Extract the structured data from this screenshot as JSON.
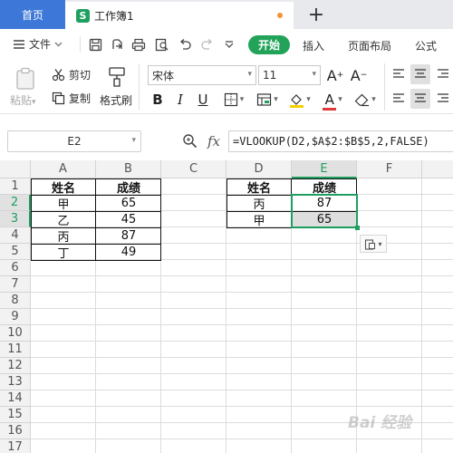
{
  "tabs": {
    "home": "首页",
    "document": "工作簿1",
    "doc_badge": "S",
    "new_tab": "+"
  },
  "menu": {
    "file": "文件",
    "start": "开始",
    "insert": "插入",
    "page_layout": "页面布局",
    "formula": "公式"
  },
  "ribbon": {
    "paste": "粘贴",
    "cut": "剪切",
    "copy": "复制",
    "format_painter": "格式刷",
    "font_name": "宋体",
    "font_size": "11",
    "bold": "B",
    "italic": "I",
    "underline": "U",
    "font_color_letter": "A",
    "font_color": "#e03b3b",
    "highlight_color": "#f5d000"
  },
  "formula_bar": {
    "cell_ref": "E2",
    "fx": "fx",
    "formula": "=VLOOKUP(D2,$A$2:$B$5,2,FALSE)"
  },
  "columns": [
    "A",
    "B",
    "C",
    "D",
    "E",
    "F"
  ],
  "rows": [
    "1",
    "2",
    "3",
    "4",
    "5",
    "6",
    "7",
    "8",
    "9",
    "10",
    "11",
    "12",
    "13",
    "14",
    "15",
    "16",
    "17"
  ],
  "sheet": {
    "A1": "姓名",
    "B1": "成绩",
    "A2": "甲",
    "B2": "65",
    "A3": "乙",
    "B3": "45",
    "A4": "丙",
    "B4": "87",
    "A5": "丁",
    "B5": "49",
    "D1": "姓名",
    "E1": "成绩",
    "D2": "丙",
    "E2": "87",
    "D3": "甲",
    "E3": "65"
  },
  "watermark": "Bai 经验"
}
